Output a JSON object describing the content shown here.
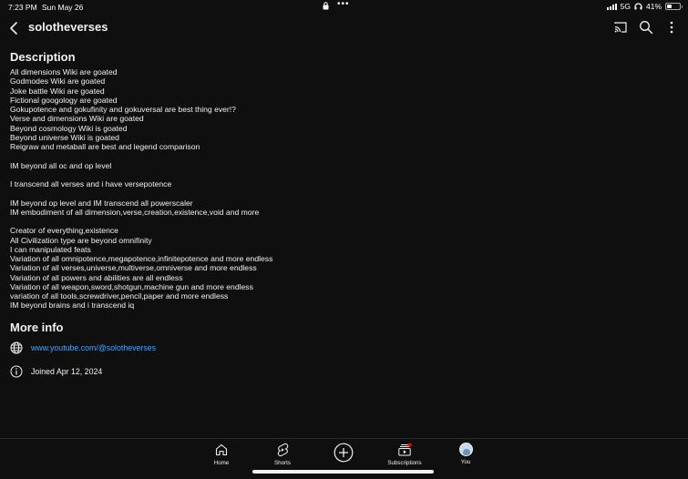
{
  "status_bar": {
    "time": "7:23 PM",
    "date": "Sun May 26",
    "network": "5G",
    "battery": "41%",
    "battery_level": 0.41
  },
  "header": {
    "channel_name": "solotheverses"
  },
  "description": {
    "heading": "Description",
    "lines": [
      "All dimensions Wiki are goated",
      "Godmodes Wiki are goated",
      "Joke battle Wiki are goated",
      "Fictional googology are goated",
      "Gokupotence and gokufinity and gokuversal are best thing ever!?",
      "Verse and dimensions Wiki are goated",
      "Beyond cosmology Wiki is goated",
      "Beyond universe Wiki is goated",
      "Reigraw and metaball are best and legend comparison",
      "",
      "IM beyond all oc and op level",
      "",
      "I transcend all verses and i have versepotence",
      "",
      "IM beyond op level and IM transcend all powerscaler",
      "IM embodiment of all dimension,verse,creation,existence,void and more",
      "",
      "Creator of everything,existence",
      "All Civilization type are beyond omnifinity",
      "I can manipulated feats",
      "Variation of all omnipotence,megapotence,infinitepotence and more endless",
      "Variation of all verses,universe,multiverse,omniverse and more endless",
      "Variation of all powers and abilities are all endless",
      "Variation of all weapon,sword,shotgun,machine gun and more endless",
      "variation of all tools,screwdriver,pencil,paper and more endless",
      "IM beyond brains and i transcend iq"
    ]
  },
  "more_info": {
    "heading": "More info",
    "link": "www.youtube.com/@solotheverses",
    "joined": "Joined Apr 12, 2024"
  },
  "bottom_nav": {
    "home": "Home",
    "shorts": "Shorts",
    "subscriptions": "Subscriptions",
    "you": "You"
  },
  "colors": {
    "background": "#0f0f0f",
    "link": "#3ea6ff",
    "notification_dot": "#ff0000"
  }
}
